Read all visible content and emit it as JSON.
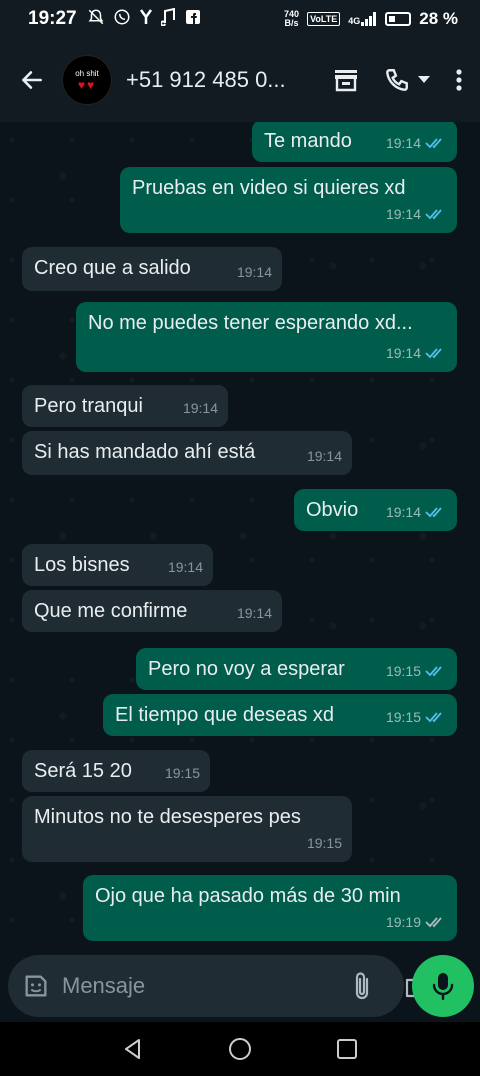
{
  "status_bar": {
    "time": "19:27",
    "net_speed_value": "740",
    "net_speed_unit": "B/s",
    "volte": "VoLTE",
    "network": "4G",
    "battery": "28 %"
  },
  "header": {
    "contact_name": "+51 912 485 0...",
    "avatar_text": "oh shit"
  },
  "messages": [
    {
      "dir": "out",
      "text": "Te mando",
      "time": "19:14",
      "read": true
    },
    {
      "dir": "out",
      "text": "Pruebas en video si quieres xd",
      "time": "19:14",
      "read": true
    },
    {
      "dir": "in",
      "text": "Creo que a salido",
      "time": "19:14"
    },
    {
      "dir": "out",
      "text": "No me puedes tener esperando xd...",
      "time": "19:14",
      "read": true
    },
    {
      "dir": "in",
      "text": "Pero tranqui",
      "time": "19:14"
    },
    {
      "dir": "in",
      "text": "Si has mandado ahí está",
      "time": "19:14"
    },
    {
      "dir": "out",
      "text": "Obvio",
      "time": "19:14",
      "read": true
    },
    {
      "dir": "in",
      "text": "Los bisnes",
      "time": "19:14"
    },
    {
      "dir": "in",
      "text": "Que me confirme",
      "time": "19:14"
    },
    {
      "dir": "out",
      "text": "Pero no voy a esperar",
      "time": "19:15",
      "read": true
    },
    {
      "dir": "out",
      "text": "El tiempo que deseas xd",
      "time": "19:15",
      "read": true
    },
    {
      "dir": "in",
      "text": "Será 15 20",
      "time": "19:15"
    },
    {
      "dir": "in",
      "text": "Minutos no te desesperes pes",
      "time": "19:15"
    },
    {
      "dir": "out",
      "text": "Ojo que ha pasado más de 30 min",
      "time": "19:19",
      "read": false
    }
  ],
  "composer": {
    "placeholder": "Mensaje"
  },
  "colors": {
    "outgoing_bubble": "#005c4b",
    "incoming_bubble": "#1f2c34",
    "background": "#0b141a",
    "accent_green": "#21c063",
    "read_tick": "#53bdeb"
  }
}
